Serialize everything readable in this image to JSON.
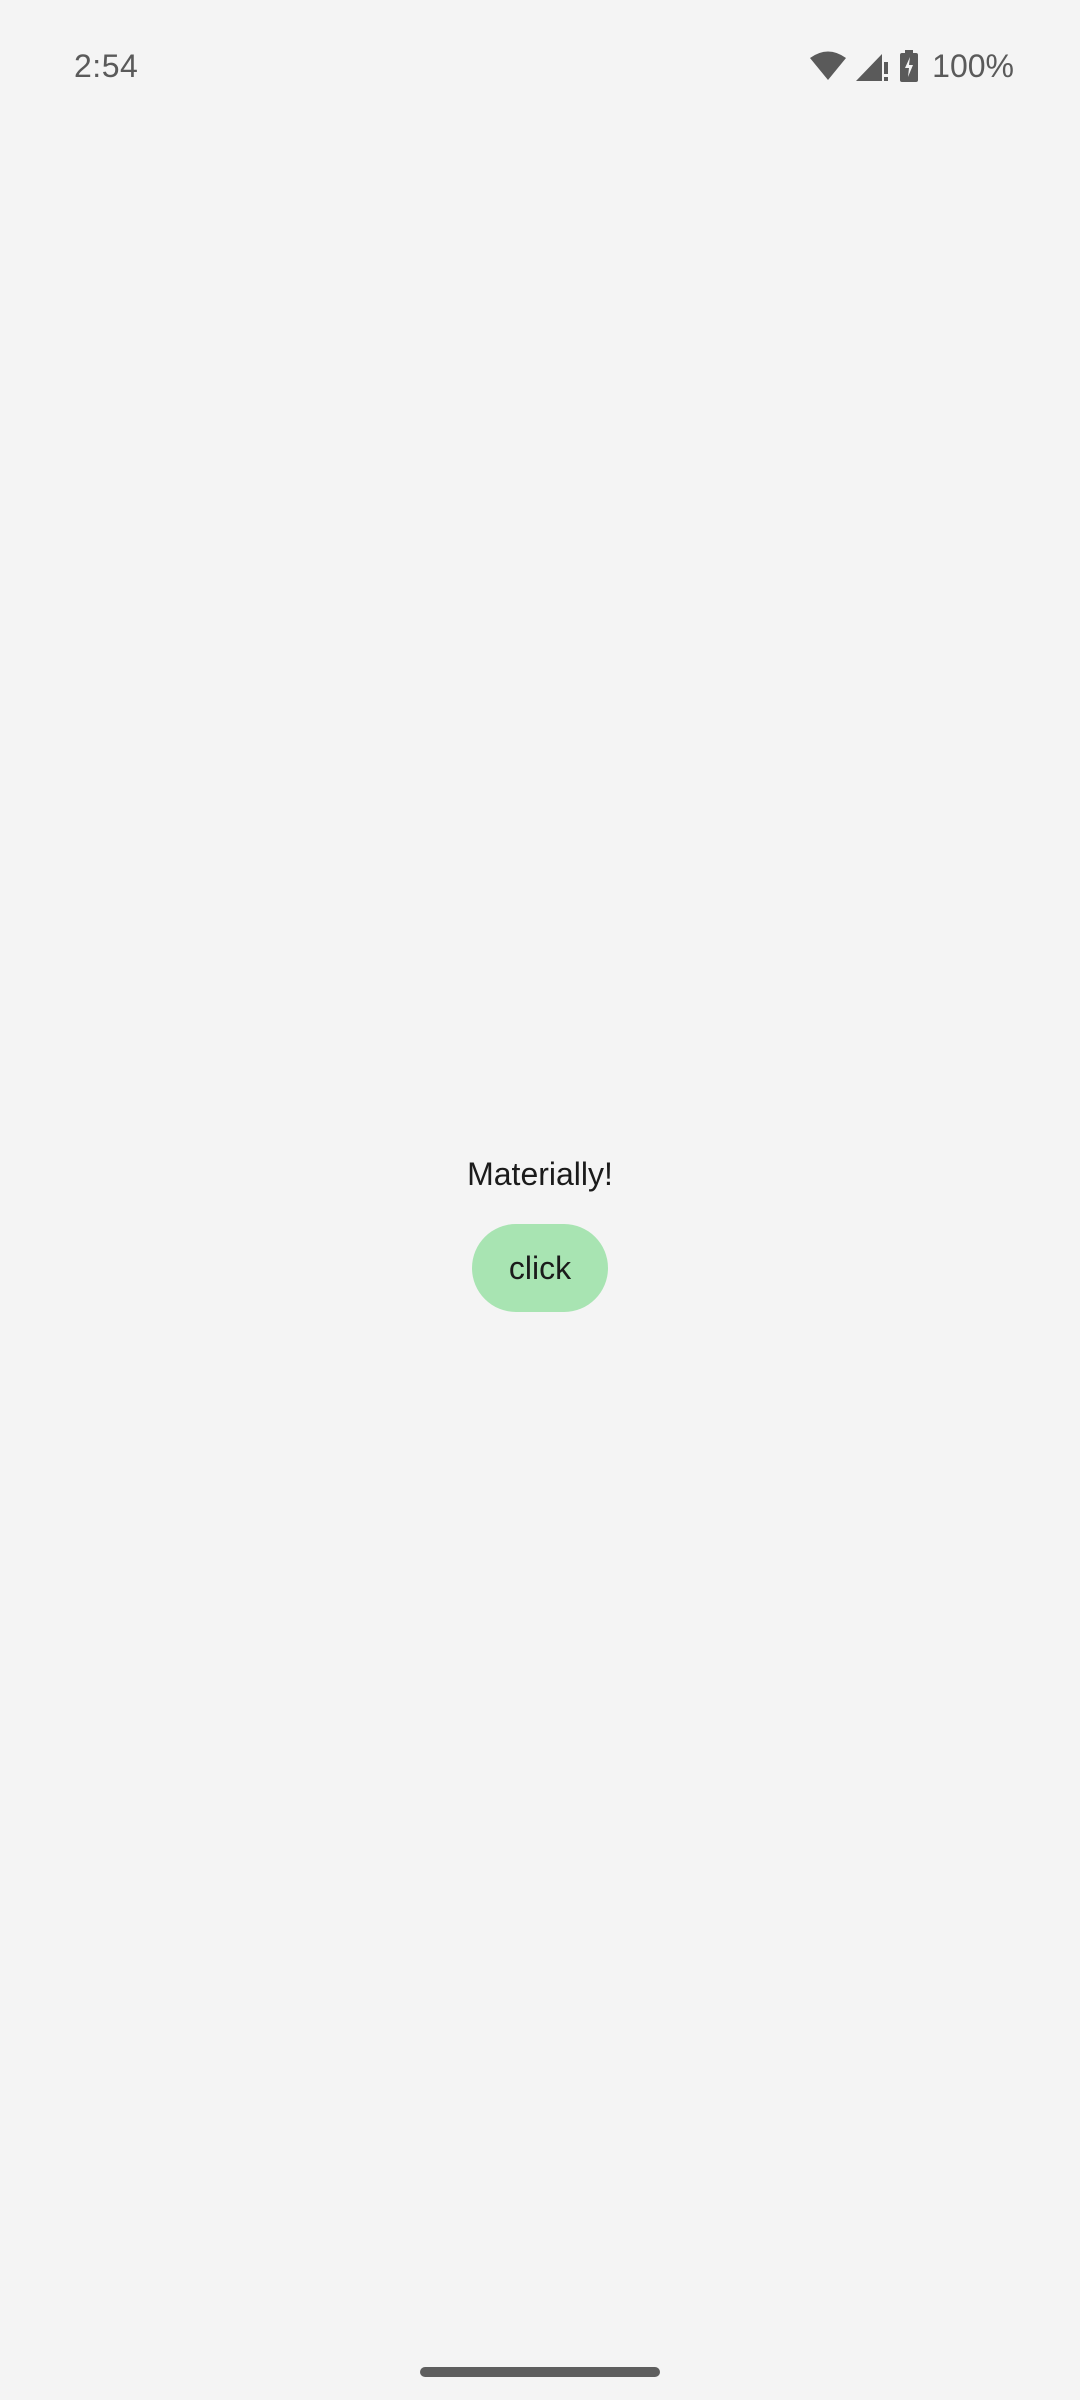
{
  "status_bar": {
    "time": "2:54",
    "battery_percent": "100%",
    "icons": [
      "wifi-icon",
      "cellular-no-data-icon",
      "battery-charging-icon"
    ]
  },
  "main": {
    "headline": "Materially!",
    "button_label": "click",
    "button_color": "#a8e4b2"
  },
  "colors": {
    "background": "#f4f4f4",
    "status_text": "#5a5a5a",
    "nav_handle": "#5e5e5e"
  }
}
